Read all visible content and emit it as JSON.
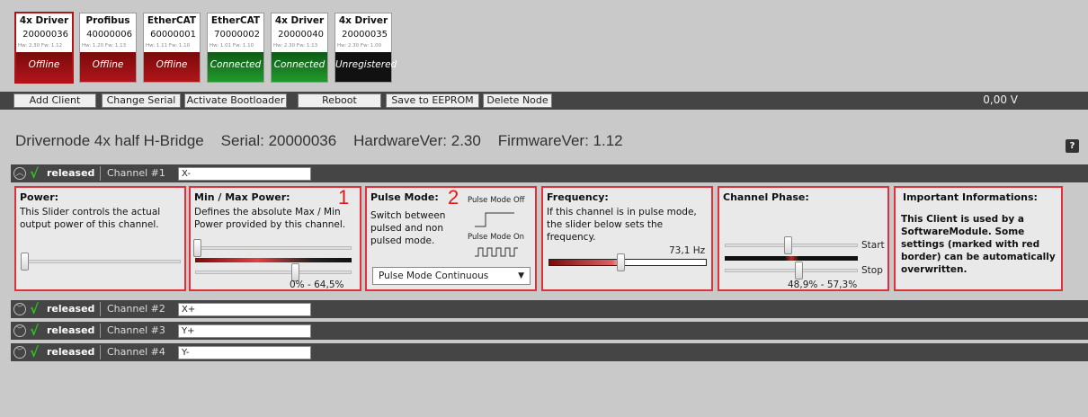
{
  "nodes": [
    {
      "title": "4x Driver",
      "serial": "20000036",
      "ver": "Hw: 2.30  Fw: 1.12",
      "status": "Offline",
      "state": "off"
    },
    {
      "title": "Profibus",
      "serial": "40000006",
      "ver": "Hw: 1.20  Fw: 1.13",
      "status": "Offline",
      "state": "off"
    },
    {
      "title": "EtherCAT",
      "serial": "60000001",
      "ver": "Hw: 1.11  Fw: 1.10",
      "status": "Offline",
      "state": "off"
    },
    {
      "title": "EtherCAT",
      "serial": "70000002",
      "ver": "Hw: 1.01  Fw: 1.10",
      "status": "Connected",
      "state": "con"
    },
    {
      "title": "4x Driver",
      "serial": "20000040",
      "ver": "Hw: 2.30  Fw: 1.13",
      "status": "Connected",
      "state": "con"
    },
    {
      "title": "4x Driver",
      "serial": "20000035",
      "ver": "Hw: 2.30  Fw: 1.00",
      "status": "Unregistered",
      "state": "unr"
    }
  ],
  "toolbar": {
    "add_client": "Add Client",
    "change_serial": "Change Serial",
    "activate_bootloader": "Activate Bootloader",
    "reboot": "Reboot",
    "save_eeprom": "Save to EEPROM",
    "delete_node": "Delete Node",
    "voltage": "0,00 V"
  },
  "header": {
    "title": "Drivernode 4x half H-Bridge    Serial: 20000036    HardwareVer: 2.30    FirmwareVer: 1.12",
    "help": "?"
  },
  "channels": [
    {
      "state": "released",
      "name": "Channel #1",
      "value": "X-"
    },
    {
      "state": "released",
      "name": "Channel #2",
      "value": "X+"
    },
    {
      "state": "released",
      "name": "Channel #3",
      "value": "Y+"
    },
    {
      "state": "released",
      "name": "Channel #4",
      "value": "Y-"
    }
  ],
  "panels": {
    "power": {
      "title": "Power:",
      "desc": "This Slider controls the actual output power of this channel."
    },
    "minmax": {
      "title": "Min / Max Power:",
      "desc": "Defines the absolute Max / Min Power provided by this channel.",
      "range": "0% - 64,5%",
      "marker": "1"
    },
    "pulse": {
      "title": "Pulse Mode:",
      "desc": "Switch between pulsed and non pulsed mode.",
      "off_label": "Pulse Mode Off",
      "on_label": "Pulse Mode On",
      "selected": "Pulse Mode Continuous",
      "marker": "2"
    },
    "freq": {
      "title": "Frequency:",
      "desc": "If this channel is in pulse mode, the slider below  sets the frequency.",
      "value": "73,1 Hz"
    },
    "phase": {
      "title": "Channel Phase:",
      "start": "Start",
      "stop": "Stop",
      "range": "48,9% - 57,3%"
    },
    "info": {
      "title": "Important Informations:",
      "text": "This Client is used by a SoftwareModule. Some settings (marked with red border) can be automatically overwritten."
    }
  }
}
